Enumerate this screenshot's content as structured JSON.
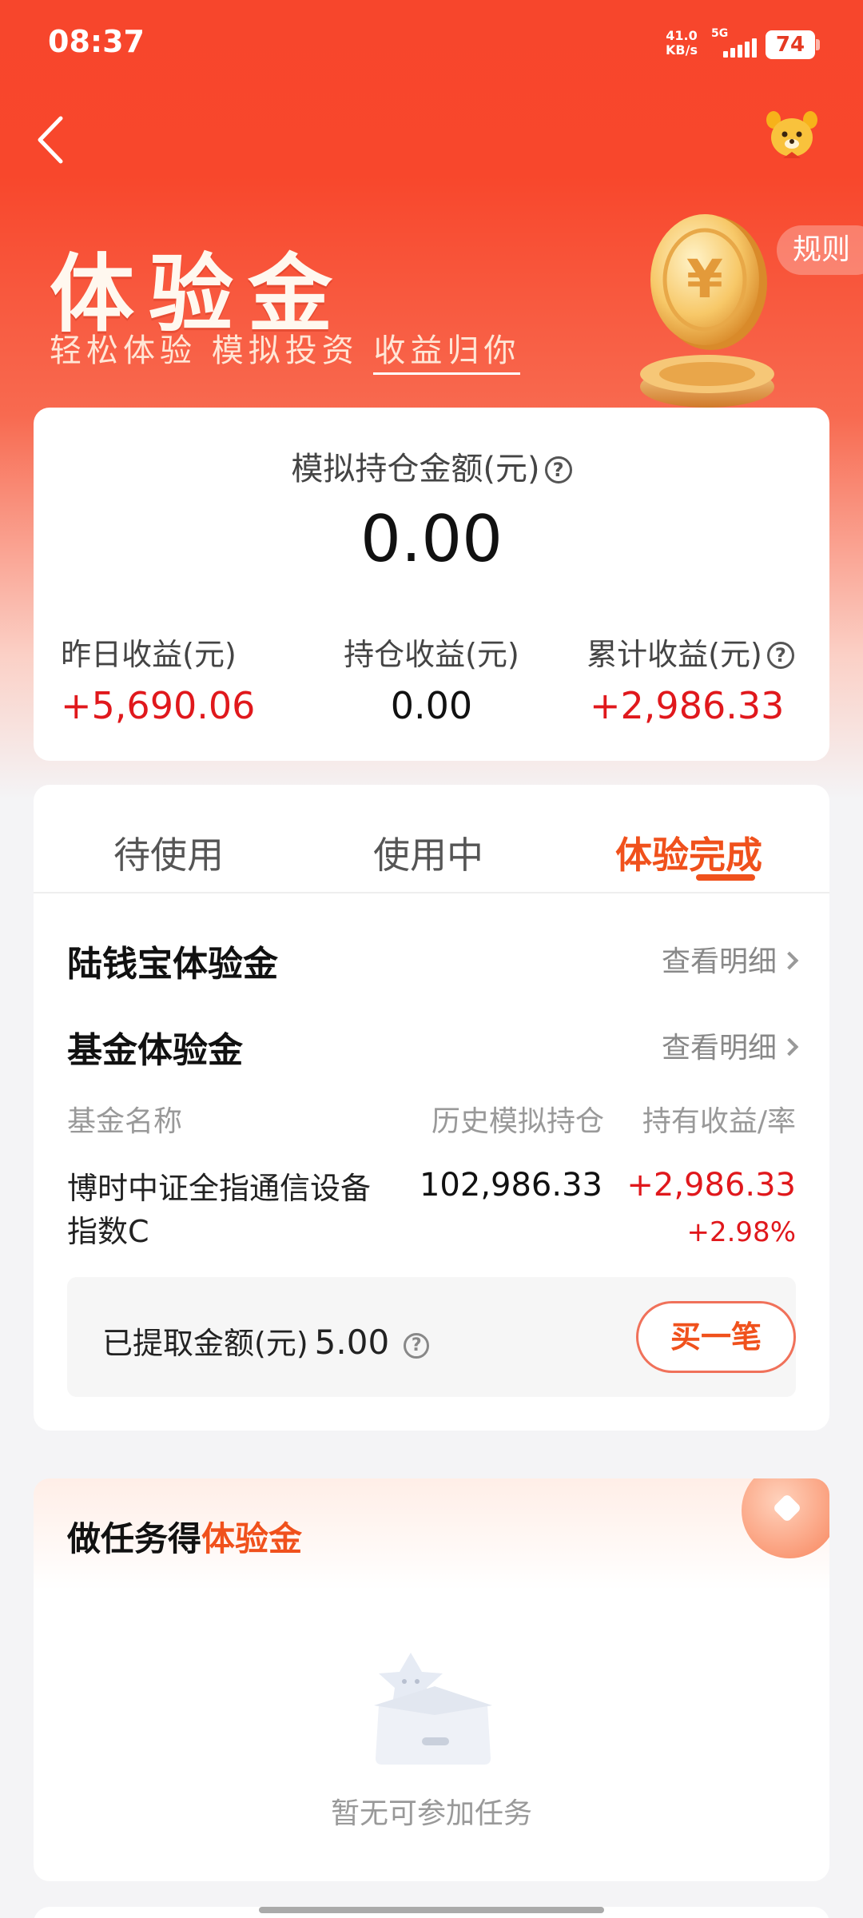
{
  "status_bar": {
    "time": "08:37",
    "net_speed_value": "41.0",
    "net_speed_unit": "KB/s",
    "network": "5G",
    "battery": "74"
  },
  "header": {
    "title": "体验金",
    "subtitle_a": "轻松体验 模拟投资 ",
    "subtitle_b": "收益归你",
    "rules_label": "规则"
  },
  "summary": {
    "mock_holding_label": "模拟持仓金额(元)",
    "mock_holding_value": "0.00",
    "stats": [
      {
        "label": "昨日收益(元)",
        "value": "+5,690.06"
      },
      {
        "label": "持仓收益(元)",
        "value": "0.00"
      },
      {
        "label": "累计收益(元)",
        "value": "+2,986.33"
      }
    ]
  },
  "tabs": [
    {
      "label": "待使用",
      "active": false
    },
    {
      "label": "使用中",
      "active": false
    },
    {
      "label": "体验完成",
      "active": true
    }
  ],
  "completed": {
    "luqianbao_title": "陆钱宝体验金",
    "fund_title": "基金体验金",
    "detail_link": "查看明细",
    "columns": [
      "基金名称",
      "历史模拟持仓",
      "持有收益/率"
    ],
    "fund": {
      "name": "博时中证全指通信设备指数C",
      "holding": "102,986.33",
      "gain": "+2,986.33",
      "rate": "+2.98%"
    },
    "withdrawn_label": "已提取金额(元)",
    "withdrawn_value": "5.00",
    "buy_label": "买一笔"
  },
  "tasks": {
    "title_prefix": "做任务得",
    "title_highlight": "体验金",
    "empty_text": "暂无可参加任务"
  },
  "colors": {
    "brand_red": "#f7462c",
    "accent_orange": "#f0511c",
    "gain_red": "#e0181c"
  },
  "icons": [
    "back-arrow-icon",
    "mascot-icon",
    "coin-icon",
    "question-icon",
    "chevron-right-icon",
    "empty-box-icon"
  ]
}
